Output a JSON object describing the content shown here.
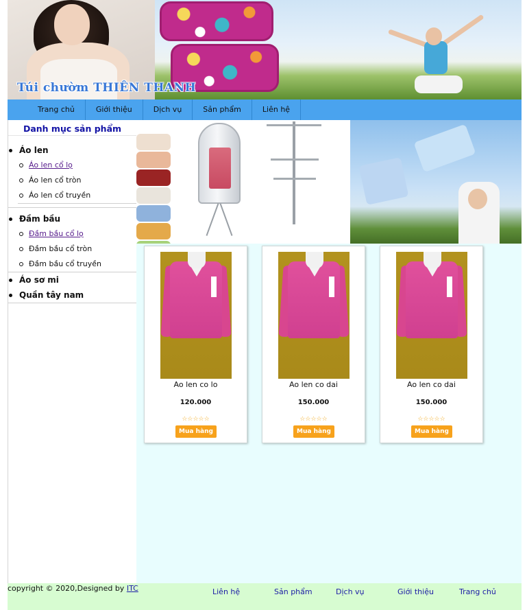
{
  "header": {
    "caption": "Túi chườm THIÊN THANH"
  },
  "nav": {
    "items": [
      "Trang chủ",
      "Giới thiệu",
      "Dịch vụ",
      "Sản phẩm",
      "Liên hệ"
    ]
  },
  "sidebar": {
    "title": "Danh mục sản phẩm",
    "categories": [
      {
        "label": "Áo len",
        "subs": [
          "Áo len cổ lọ",
          "Áo len cổ tròn",
          "Áo len cổ truyền"
        ]
      },
      {
        "label": "Đầm bầu",
        "subs": [
          "Đầm bầu cổ lọ",
          "Đầm bầu cổ tròn",
          "Đầm bầu cổ truyền"
        ]
      },
      {
        "label": "Áo sơ mi",
        "subs": []
      },
      {
        "label": "Quần tây nam",
        "subs": []
      }
    ]
  },
  "products": [
    {
      "name": "Ao len co lo",
      "price": "120.000",
      "rating": 0,
      "stars": "☆☆☆☆☆",
      "buy_label": "Mua hàng"
    },
    {
      "name": "Ao len co dai",
      "price": "150.000",
      "rating": 0,
      "stars": "☆☆☆☆☆",
      "buy_label": "Mua hàng"
    },
    {
      "name": "Ao len co dai",
      "price": "150.000",
      "rating": 0,
      "stars": "☆☆☆☆☆",
      "buy_label": "Mua hàng"
    }
  ],
  "footer": {
    "copyright": "copyright © 2020,Designed by ",
    "designer": "ITC",
    "links": [
      "Liên hệ",
      "Sản phẩm",
      "Dịch vụ",
      "Giới thiệu",
      "Trang chủ"
    ]
  },
  "colors": {
    "nav_bg": "#4aa3ee",
    "content_bg": "#e8fdfe",
    "footer_bg": "#d7fcd1",
    "buy_button": "#f7a21c",
    "sidebar_title": "#1313a5"
  }
}
